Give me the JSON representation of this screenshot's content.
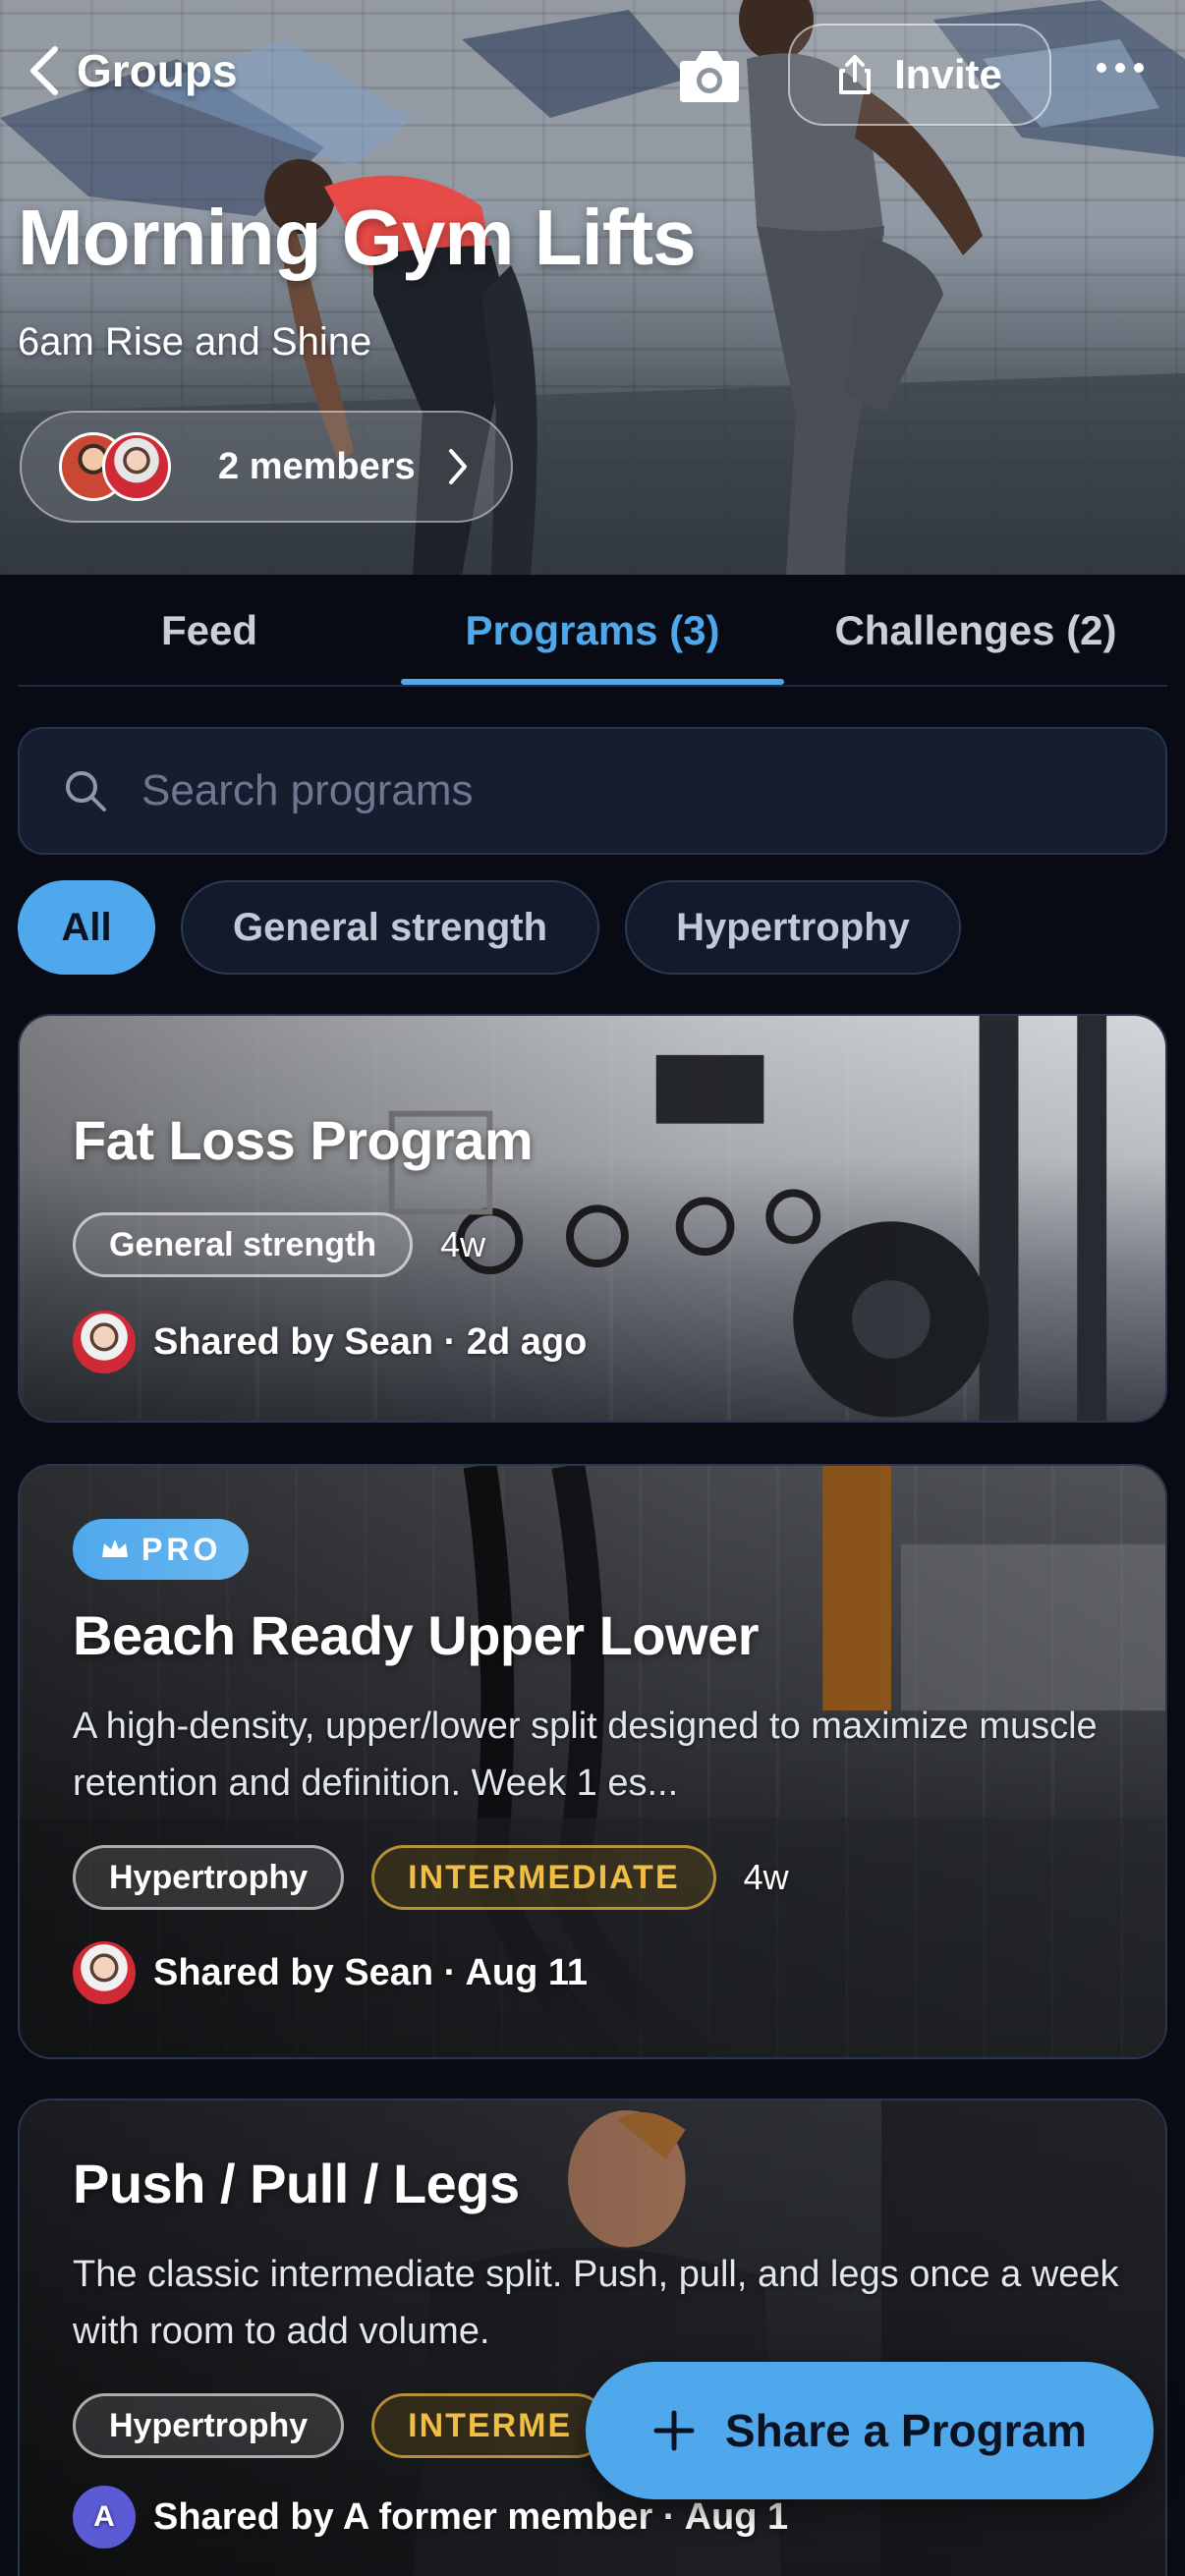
{
  "header": {
    "back_label": "Groups",
    "invite_label": "Invite",
    "group_title": "Morning Gym Lifts",
    "group_subtitle": "6am Rise and Shine",
    "members_label": "2 members"
  },
  "tabs": [
    {
      "label": "Feed",
      "active": false
    },
    {
      "label": "Programs (3)",
      "active": true
    },
    {
      "label": "Challenges (2)",
      "active": false
    }
  ],
  "search": {
    "placeholder": "Search programs"
  },
  "filters": [
    {
      "label": "All",
      "selected": true
    },
    {
      "label": "General strength",
      "selected": false
    },
    {
      "label": "Hypertrophy",
      "selected": false
    }
  ],
  "programs": [
    {
      "title": "Fat Loss Program",
      "tags": [
        "General strength"
      ],
      "duration": "4w",
      "shared": "Shared by Sean · 2d ago"
    },
    {
      "badge": "PRO",
      "title": "Beach Ready Upper Lower",
      "description": "A high-density, upper/lower split designed to maximize muscle retention and definition. Week 1 es...",
      "tags": [
        "Hypertrophy"
      ],
      "level": "INTERMEDIATE",
      "duration": "4w",
      "shared": "Shared by Sean · Aug 11"
    },
    {
      "title": "Push / Pull / Legs",
      "description": "The classic intermediate split. Push, pull, and legs once a week with room to add volume.",
      "tags": [
        "Hypertrophy"
      ],
      "level": "INTERME",
      "avatar_letter": "A",
      "shared": "Shared by A former member · Aug 1"
    }
  ],
  "fab": {
    "label": "Share a Program"
  },
  "colors": {
    "accent": "#4fa8ec",
    "background": "#080b14",
    "surface": "#151d2e",
    "level_gold": "#f0be43"
  },
  "icons": [
    "chevron-left-icon",
    "camera-icon",
    "share-icon",
    "more-icon",
    "chevron-right-icon",
    "search-icon",
    "crown-icon",
    "plus-icon"
  ]
}
